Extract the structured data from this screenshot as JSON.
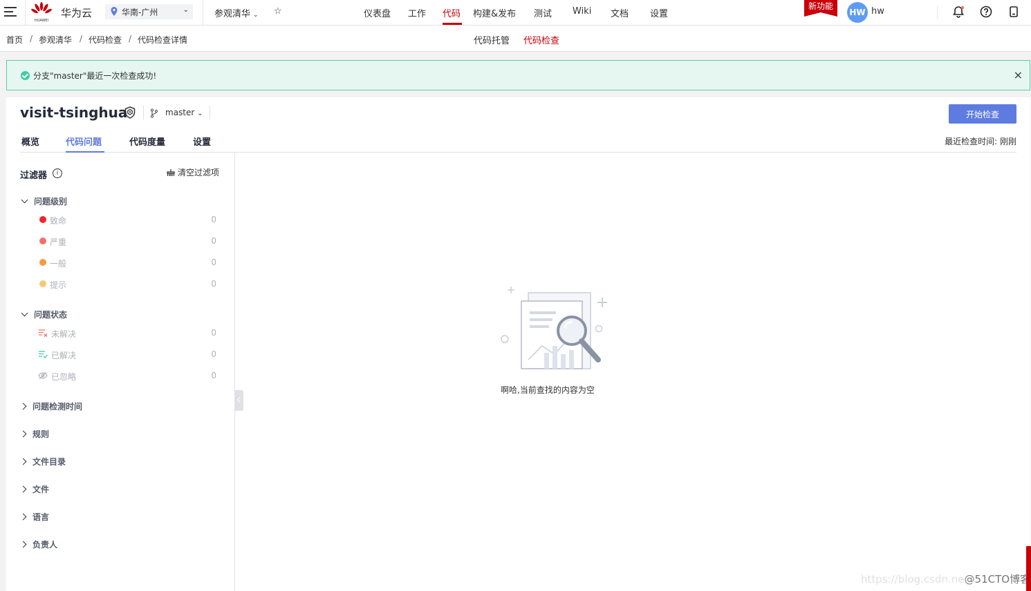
{
  "topbar": {
    "brand": "华为云",
    "logo_text": "HUAWEI",
    "region": "华南-广州",
    "project": "参观清华",
    "nav": [
      "仪表盘",
      "工作",
      "代码",
      "构建&发布",
      "测试",
      "Wiki",
      "文档",
      "设置"
    ],
    "active_nav": "代码",
    "new_feature": "新功能",
    "avatar": "HW",
    "username": "hw"
  },
  "breadcrumb": [
    "首页",
    "参观清华",
    "代码检查",
    "代码检查详情"
  ],
  "breadcrumb_sep": "/",
  "subnav": [
    "代码托管",
    "代码检查"
  ],
  "alert": {
    "message": "分支\"master\"最近一次检查成功!",
    "close": "×"
  },
  "repo": {
    "name": "visit-tsinghua",
    "branch": "master",
    "start_button": "开始检查",
    "tabs": [
      "概览",
      "代码问题",
      "代码度量",
      "设置"
    ],
    "last_check": "最近检查时间: 刚刚"
  },
  "filter": {
    "title": "过滤器",
    "clear": "清空过滤项",
    "severity_group": "问题级别",
    "severity": [
      {
        "label": "致命",
        "count": "0",
        "color": "#f5222d"
      },
      {
        "label": "严重",
        "count": "0",
        "color": "#f66f6a"
      },
      {
        "label": "一般",
        "count": "0",
        "color": "#fa9841"
      },
      {
        "label": "提示",
        "count": "0",
        "color": "#f3c97a"
      }
    ],
    "status_group": "问题状态",
    "status": [
      {
        "label": "未解决",
        "count": "0"
      },
      {
        "label": "已解决",
        "count": "0"
      },
      {
        "label": "已忽略",
        "count": "0"
      }
    ],
    "collapsed_groups": [
      "问题检测时间",
      "规则",
      "文件目录",
      "文件",
      "语言",
      "负责人"
    ]
  },
  "empty": {
    "text": "啊哈,当前查找的内容为空"
  },
  "watermark": {
    "faint": "https://blog.csdn.ne",
    "strong": "@51CTO博客"
  },
  "colors": {
    "brand_red": "#c7000b",
    "primary": "#5e7ce0",
    "success": "#3dcca6"
  }
}
